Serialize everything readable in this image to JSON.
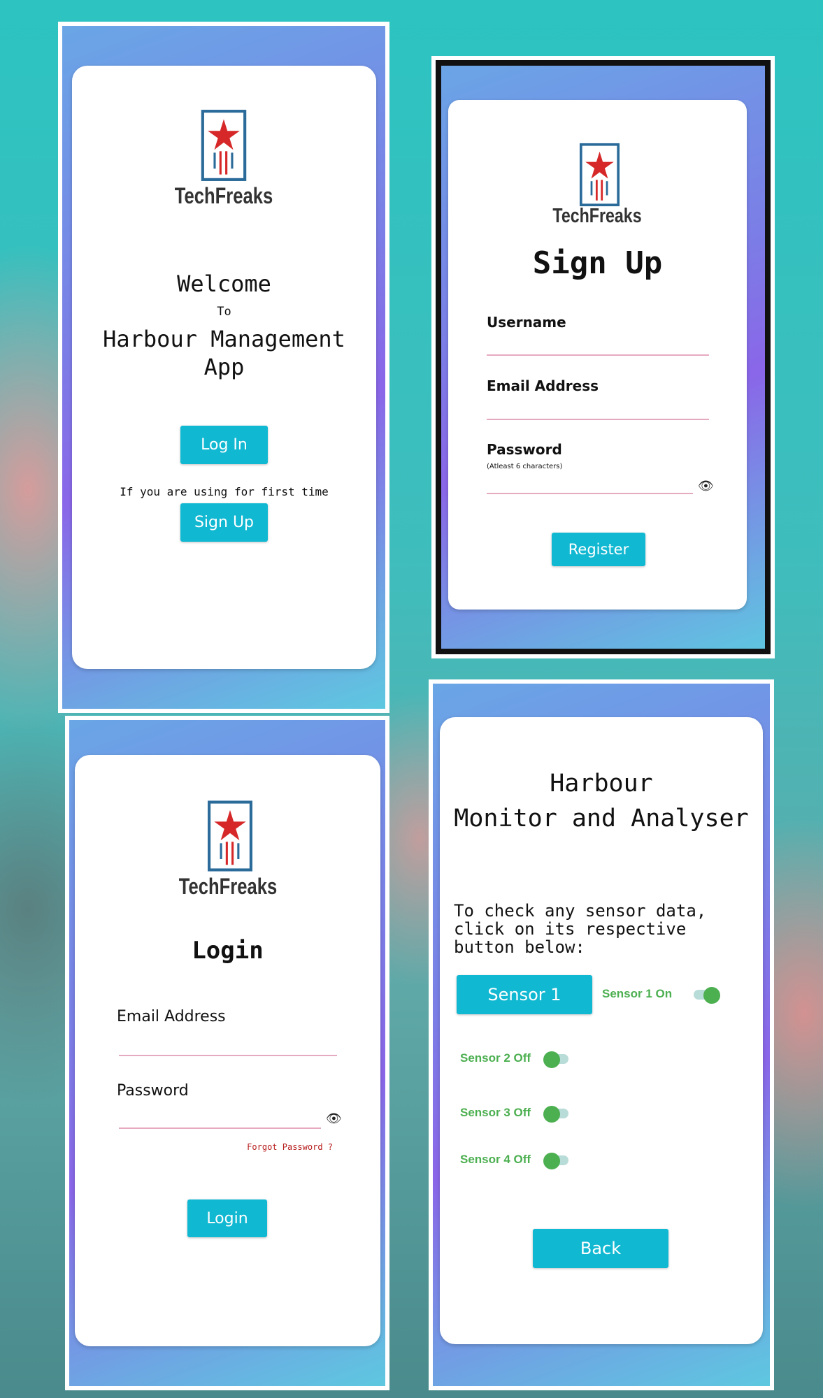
{
  "brand": "TechFreaks",
  "welcome": {
    "title": "Welcome",
    "to": "To",
    "app_line1": "Harbour Management",
    "app_line2": "App",
    "login_button": "Log In",
    "first_time_text": "If you are using for first time",
    "signup_button": "Sign Up"
  },
  "signup": {
    "title": "Sign Up",
    "username_label": "Username",
    "email_label": "Email Address",
    "password_label": "Password",
    "password_hint": "(Atleast 6 characters)",
    "register_button": "Register"
  },
  "login": {
    "title": "Login",
    "email_label": "Email Address",
    "password_label": "Password",
    "forgot_password": "Forgot Password ?",
    "login_button": "Login"
  },
  "monitor": {
    "title_line1": "Harbour",
    "title_line2": "Monitor and Analyser",
    "instructions": "To check any sensor data, click on its respective button below:",
    "sensor1_button": "Sensor 1",
    "sensors": [
      {
        "label": "Sensor 1 On",
        "on": true
      },
      {
        "label": "Sensor 2 Off",
        "on": false
      },
      {
        "label": "Sensor 3 Off",
        "on": false
      },
      {
        "label": "Sensor 4 Off",
        "on": false
      }
    ],
    "back_button": "Back"
  },
  "colors": {
    "accent": "#11b8d2",
    "toggle": "#4caf50",
    "logo_star": "#d62828",
    "logo_frame": "#2b6b9a"
  }
}
